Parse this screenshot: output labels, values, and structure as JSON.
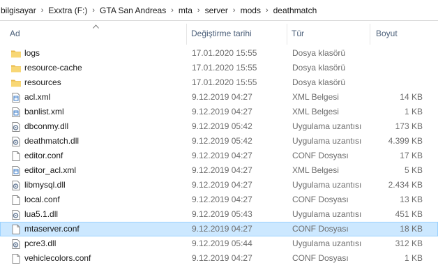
{
  "breadcrumb": [
    "bilgisayar",
    "Exxtra (F:)",
    "GTA San Andreas",
    "mta",
    "server",
    "mods",
    "deathmatch"
  ],
  "columns": {
    "name": "Ad",
    "date": "Değiştirme tarihi",
    "type": "Tür",
    "size": "Boyut"
  },
  "sort": {
    "column": "name",
    "icon": "chevron-up-icon"
  },
  "files": [
    {
      "name": "logs",
      "date": "17.01.2020 15:55",
      "type": "Dosya klasörü",
      "size": "",
      "icon": "folder-icon"
    },
    {
      "name": "resource-cache",
      "date": "17.01.2020 15:55",
      "type": "Dosya klasörü",
      "size": "",
      "icon": "folder-icon"
    },
    {
      "name": "resources",
      "date": "17.01.2020 15:55",
      "type": "Dosya klasörü",
      "size": "",
      "icon": "folder-icon"
    },
    {
      "name": "acl.xml",
      "date": "9.12.2019 04:27",
      "type": "XML Belgesi",
      "size": "14 KB",
      "icon": "xml-file-icon"
    },
    {
      "name": "banlist.xml",
      "date": "9.12.2019 04:27",
      "type": "XML Belgesi",
      "size": "1 KB",
      "icon": "xml-file-icon"
    },
    {
      "name": "dbconmy.dll",
      "date": "9.12.2019 05:42",
      "type": "Uygulama uzantısı",
      "size": "173 KB",
      "icon": "dll-file-icon"
    },
    {
      "name": "deathmatch.dll",
      "date": "9.12.2019 05:42",
      "type": "Uygulama uzantısı",
      "size": "4.399 KB",
      "icon": "dll-file-icon"
    },
    {
      "name": "editor.conf",
      "date": "9.12.2019 04:27",
      "type": "CONF Dosyası",
      "size": "17 KB",
      "icon": "file-icon"
    },
    {
      "name": "editor_acl.xml",
      "date": "9.12.2019 04:27",
      "type": "XML Belgesi",
      "size": "5 KB",
      "icon": "xml-file-icon"
    },
    {
      "name": "libmysql.dll",
      "date": "9.12.2019 04:27",
      "type": "Uygulama uzantısı",
      "size": "2.434 KB",
      "icon": "dll-file-icon"
    },
    {
      "name": "local.conf",
      "date": "9.12.2019 04:27",
      "type": "CONF Dosyası",
      "size": "13 KB",
      "icon": "file-icon"
    },
    {
      "name": "lua5.1.dll",
      "date": "9.12.2019 05:43",
      "type": "Uygulama uzantısı",
      "size": "451 KB",
      "icon": "dll-file-icon"
    },
    {
      "name": "mtaserver.conf",
      "date": "9.12.2019 04:27",
      "type": "CONF Dosyası",
      "size": "18 KB",
      "icon": "file-icon",
      "selected": true
    },
    {
      "name": "pcre3.dll",
      "date": "9.12.2019 05:44",
      "type": "Uygulama uzantısı",
      "size": "312 KB",
      "icon": "dll-file-icon"
    },
    {
      "name": "vehiclecolors.conf",
      "date": "9.12.2019 04:27",
      "type": "CONF Dosyası",
      "size": "1 KB",
      "icon": "file-icon"
    }
  ],
  "colors": {
    "selection_bg": "#cce8ff",
    "selection_border": "#99d1ff",
    "header_text": "#4c607a",
    "folder": "#f8d775"
  }
}
